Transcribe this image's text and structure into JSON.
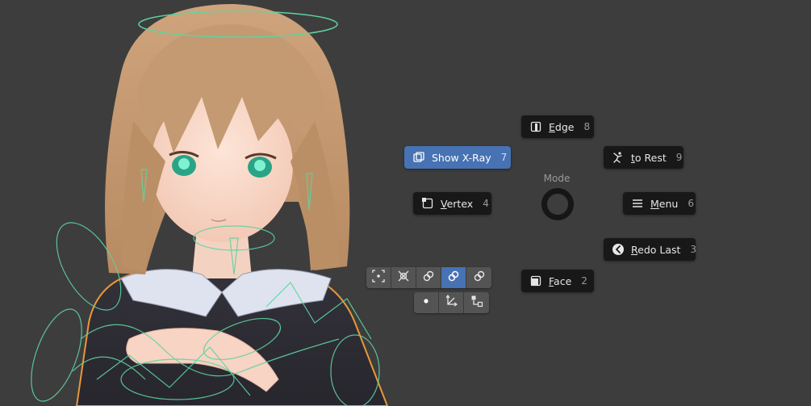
{
  "pie_menu": {
    "title": "Mode",
    "items": {
      "edge": {
        "prefix": "",
        "mnemonic": "E",
        "rest": "dge",
        "key": "8",
        "icon": "edge-select-icon"
      },
      "xray": {
        "prefix": "",
        "mnemonic": "",
        "rest": "Show X-Ray",
        "key": "7",
        "icon": "xray-icon",
        "active": true
      },
      "rest": {
        "prefix": "",
        "mnemonic": "t",
        "rest": "o Rest",
        "key": "9",
        "icon": "pose-rest-icon"
      },
      "vertex": {
        "prefix": "",
        "mnemonic": "V",
        "rest": "ertex",
        "key": "4",
        "icon": "vertex-select-icon"
      },
      "menu": {
        "prefix": "",
        "mnemonic": "M",
        "rest": "enu",
        "key": "6",
        "icon": "hamburger-menu-icon"
      },
      "redo": {
        "prefix": "",
        "mnemonic": "R",
        "rest": "edo Last",
        "key": "3",
        "icon": "redo-icon"
      },
      "face": {
        "prefix": "",
        "mnemonic": "F",
        "rest": "ace",
        "key": "2",
        "icon": "face-select-icon"
      }
    }
  },
  "toolbar_top": {
    "buttons": [
      {
        "icon": "snap-bounding-icon"
      },
      {
        "icon": "snap-center-icon"
      },
      {
        "icon": "link-icon"
      },
      {
        "icon": "link-active-icon",
        "active": true
      },
      {
        "icon": "unlink-icon"
      }
    ]
  },
  "toolbar_bottom": {
    "buttons": [
      {
        "icon": "dot-icon"
      },
      {
        "icon": "transform-axes-icon"
      },
      {
        "icon": "parent-hierarchy-icon"
      }
    ]
  },
  "colors": {
    "background": "#3d3d3d",
    "button": "#181818",
    "active": "#4772b3",
    "bone_wire": "#5fd3a0",
    "selection_outline": "#e8983a",
    "hair": "#c49a72"
  }
}
